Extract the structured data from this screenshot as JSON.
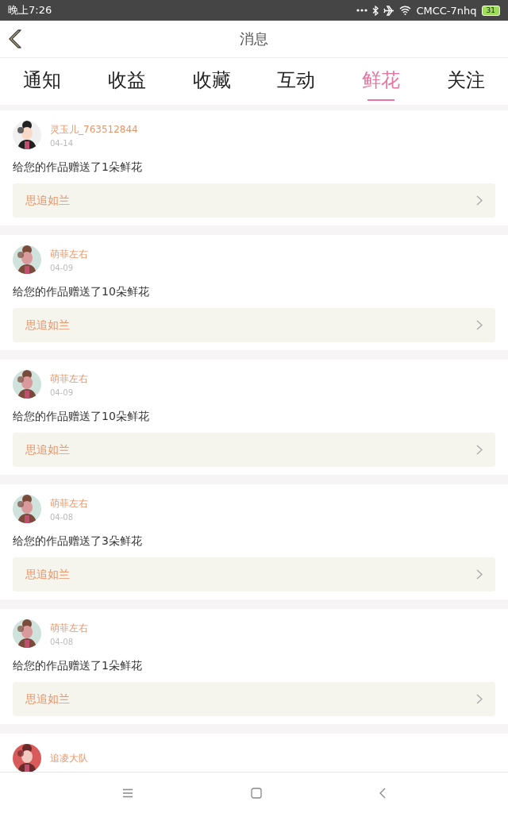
{
  "status_bar": {
    "time": "晚上7:26",
    "network": "CMCC-7nhq",
    "battery": "31"
  },
  "header": {
    "title": "消息"
  },
  "tabs": [
    {
      "label": "通知",
      "selected": false
    },
    {
      "label": "收益",
      "selected": false
    },
    {
      "label": "收藏",
      "selected": false
    },
    {
      "label": "互动",
      "selected": false
    },
    {
      "label": "鲜花",
      "selected": true
    },
    {
      "label": "关注",
      "selected": false
    }
  ],
  "messages": [
    {
      "user": "灵玉儿_763512844",
      "date": "04-14",
      "text": "给您的作品赠送了1朵鲜花",
      "work": "思追如兰"
    },
    {
      "user": "萌菲左右",
      "date": "04-09",
      "text": "给您的作品赠送了10朵鲜花",
      "work": "思追如兰"
    },
    {
      "user": "萌菲左右",
      "date": "04-09",
      "text": "给您的作品赠送了10朵鲜花",
      "work": "思追如兰"
    },
    {
      "user": "萌菲左右",
      "date": "04-08",
      "text": "给您的作品赠送了3朵鲜花",
      "work": "思追如兰"
    },
    {
      "user": "萌菲左右",
      "date": "04-08",
      "text": "给您的作品赠送了1朵鲜花",
      "work": "思追如兰"
    },
    {
      "user": "追凌大队"
    }
  ]
}
